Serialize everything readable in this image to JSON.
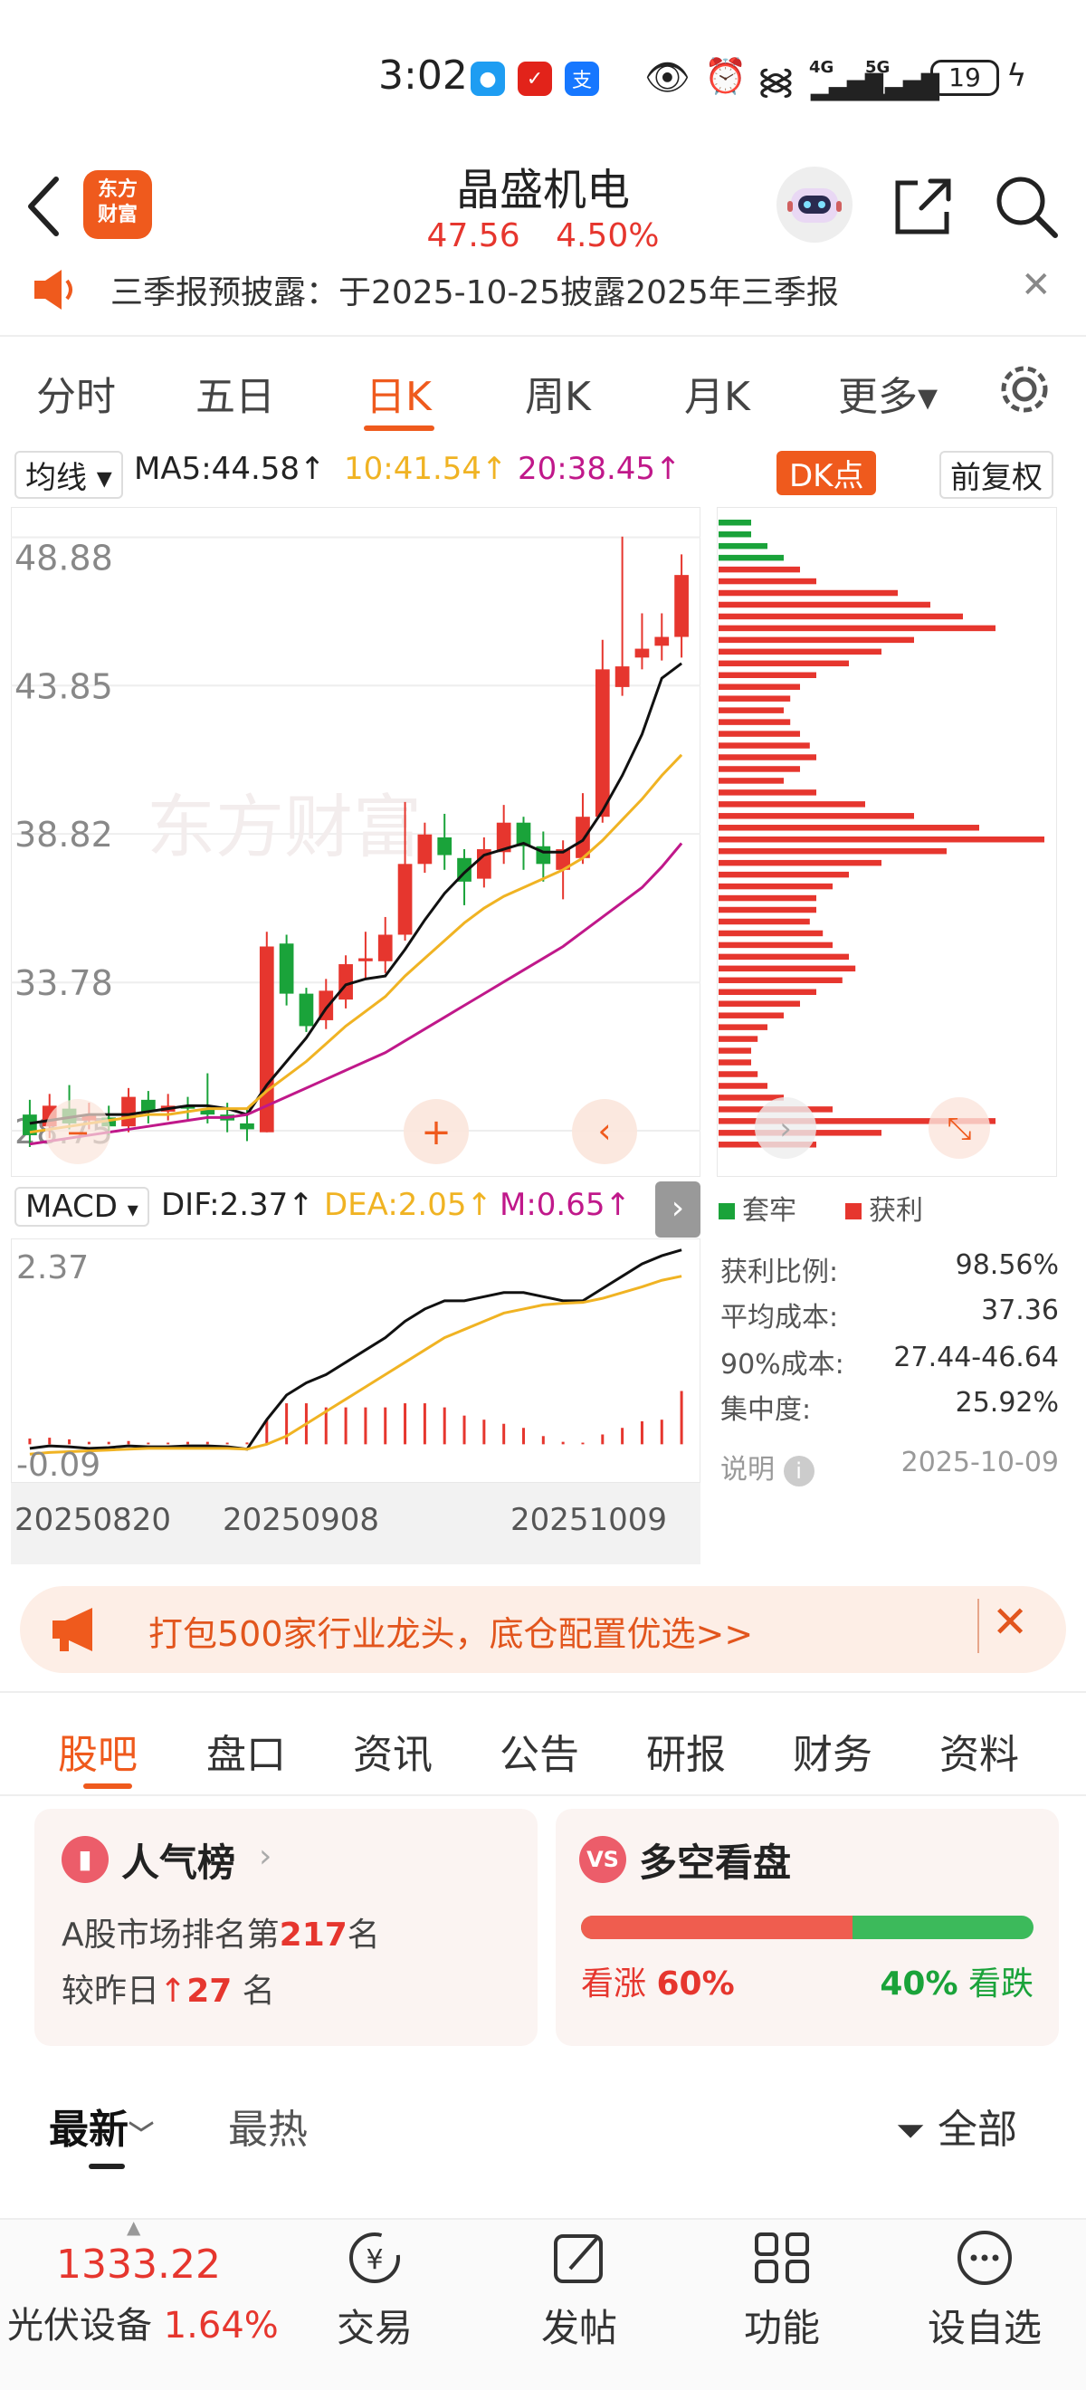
{
  "status_bar": {
    "time": "3:02",
    "battery": "19",
    "network_labels": [
      "4G",
      "5G"
    ],
    "app_icons": [
      "message-icon",
      "app-red-icon",
      "alipay-icon"
    ]
  },
  "header": {
    "logo_text_line1": "东方",
    "logo_text_line2": "财富",
    "stock_name": "晶盛机电",
    "price": "47.56",
    "change_pct": "4.50%"
  },
  "notice": {
    "text": "三季报预披露：于2025-10-25披露2025年三季报"
  },
  "period_tabs": [
    {
      "label": "分时"
    },
    {
      "label": "五日"
    },
    {
      "label": "日K"
    },
    {
      "label": "周K"
    },
    {
      "label": "月K"
    },
    {
      "label": "更多▾"
    }
  ],
  "ma_legend": {
    "selector": "均线",
    "ma5": "MA5:44.58↑",
    "ma10": "10:41.54↑",
    "ma20": "20:38.45↑",
    "dk_button": "DK点",
    "adjust_button": "前复权"
  },
  "price_axis": [
    "48.88",
    "43.85",
    "38.82",
    "33.78",
    "28.75"
  ],
  "macd_legend": {
    "selector": "MACD",
    "dif": "DIF:2.37↑",
    "dea": "DEA:2.05↑",
    "m": "M:0.65↑"
  },
  "macd_axis": {
    "top": "2.37",
    "bottom": "-0.09"
  },
  "date_axis": [
    "20250820",
    "20250908",
    "20251009"
  ],
  "chip_legend": {
    "trapped": "套牢",
    "profit": "获利"
  },
  "chip_stats": [
    {
      "label": "获利比例:",
      "value": "98.56%"
    },
    {
      "label": "平均成本:",
      "value": "37.36"
    },
    {
      "label": "90%成本:",
      "value": "27.44-46.64"
    },
    {
      "label": "集中度:",
      "value": "25.92%"
    }
  ],
  "chip_note": {
    "label": "说明",
    "date": "2025-10-09"
  },
  "promo": {
    "text": "打包500家行业龙头，底仓配置优选>>"
  },
  "section_tabs": [
    {
      "label": "股吧"
    },
    {
      "label": "盘口"
    },
    {
      "label": "资讯"
    },
    {
      "label": "公告"
    },
    {
      "label": "研报"
    },
    {
      "label": "财务"
    },
    {
      "label": "资料"
    }
  ],
  "popularity_card": {
    "title": "人气榜",
    "line1_prefix": "A股市场排名第",
    "rank": "217",
    "line1_suffix": "名",
    "line2_prefix": "较昨日",
    "change": "27",
    "line2_suffix": "名"
  },
  "sentiment_card": {
    "title": "多空看盘",
    "bull_label": "看涨",
    "bull_pct": "60%",
    "bear_pct": "40%",
    "bear_label": "看跌",
    "bull_fraction": 0.6
  },
  "feed_tabs": {
    "latest": "最新",
    "hot": "最热",
    "filter": "全部"
  },
  "bottom_bar": {
    "index_value": "1333.22",
    "index_name": "光伏设备",
    "index_change": "1.64%",
    "items": [
      {
        "label": "交易"
      },
      {
        "label": "发帖"
      },
      {
        "label": "功能"
      },
      {
        "label": "设自选"
      }
    ]
  },
  "colors": {
    "accent": "#ef5a1d",
    "up": "#e6362e",
    "down": "#1aa33a",
    "ma5": "#111111",
    "ma10": "#f0b323",
    "ma20": "#c0188a"
  },
  "chart_data": {
    "type": "candlestick",
    "ylim": [
      27.8,
      49.6
    ],
    "candles": [
      {
        "o": 29.3,
        "c": 28.6,
        "h": 29.8,
        "l": 28.2
      },
      {
        "o": 28.9,
        "c": 29.6,
        "h": 30.0,
        "l": 28.5
      },
      {
        "o": 29.5,
        "c": 29.0,
        "h": 30.3,
        "l": 28.8
      },
      {
        "o": 29.1,
        "c": 29.3,
        "h": 29.7,
        "l": 28.8
      },
      {
        "o": 29.2,
        "c": 28.9,
        "h": 29.6,
        "l": 28.6
      },
      {
        "o": 28.9,
        "c": 29.9,
        "h": 30.2,
        "l": 28.7
      },
      {
        "o": 29.8,
        "c": 29.4,
        "h": 30.1,
        "l": 29.0
      },
      {
        "o": 29.4,
        "c": 29.6,
        "h": 30.0,
        "l": 29.1
      },
      {
        "o": 29.6,
        "c": 29.5,
        "h": 29.9,
        "l": 29.1
      },
      {
        "o": 29.5,
        "c": 29.3,
        "h": 30.7,
        "l": 29.0
      },
      {
        "o": 29.3,
        "c": 29.1,
        "h": 29.7,
        "l": 28.7
      },
      {
        "o": 29.0,
        "c": 28.8,
        "h": 29.5,
        "l": 28.4
      },
      {
        "o": 28.7,
        "c": 35.0,
        "h": 35.5,
        "l": 28.7
      },
      {
        "o": 35.1,
        "c": 33.4,
        "h": 35.4,
        "l": 33.0
      },
      {
        "o": 33.4,
        "c": 32.3,
        "h": 33.6,
        "l": 32.1
      },
      {
        "o": 32.5,
        "c": 33.5,
        "h": 33.9,
        "l": 32.2
      },
      {
        "o": 33.2,
        "c": 34.4,
        "h": 34.7,
        "l": 32.9
      },
      {
        "o": 34.5,
        "c": 34.6,
        "h": 35.5,
        "l": 33.9
      },
      {
        "o": 34.5,
        "c": 35.4,
        "h": 36.0,
        "l": 34.1
      },
      {
        "o": 35.4,
        "c": 37.8,
        "h": 39.9,
        "l": 35.2
      },
      {
        "o": 37.8,
        "c": 38.8,
        "h": 39.2,
        "l": 37.5
      },
      {
        "o": 38.7,
        "c": 38.1,
        "h": 39.5,
        "l": 37.6
      },
      {
        "o": 38.0,
        "c": 37.2,
        "h": 38.3,
        "l": 36.4
      },
      {
        "o": 37.3,
        "c": 38.3,
        "h": 38.7,
        "l": 37.0
      },
      {
        "o": 38.2,
        "c": 39.2,
        "h": 39.8,
        "l": 37.8
      },
      {
        "o": 39.2,
        "c": 38.4,
        "h": 39.4,
        "l": 37.6
      },
      {
        "o": 38.4,
        "c": 37.8,
        "h": 38.9,
        "l": 37.2
      },
      {
        "o": 37.6,
        "c": 38.3,
        "h": 38.6,
        "l": 36.6
      },
      {
        "o": 38.0,
        "c": 39.4,
        "h": 40.2,
        "l": 37.8
      },
      {
        "o": 39.4,
        "c": 44.4,
        "h": 45.4,
        "l": 39.2
      },
      {
        "o": 43.8,
        "c": 44.5,
        "h": 48.9,
        "l": 43.5
      },
      {
        "o": 44.8,
        "c": 45.1,
        "h": 46.3,
        "l": 44.4
      },
      {
        "o": 45.2,
        "c": 45.5,
        "h": 46.3,
        "l": 44.7
      },
      {
        "o": 45.5,
        "c": 47.6,
        "h": 48.3,
        "l": 44.8
      }
    ],
    "ma5": [
      29.0,
      29.1,
      29.2,
      29.3,
      29.3,
      29.3,
      29.4,
      29.5,
      29.6,
      29.6,
      29.5,
      29.3,
      30.3,
      31.1,
      31.9,
      32.9,
      33.7,
      33.9,
      34.0,
      34.9,
      35.9,
      36.8,
      37.5,
      38.1,
      38.3,
      38.5,
      38.2,
      38.2,
      38.6,
      39.6,
      40.8,
      42.2,
      44.1,
      44.6
    ],
    "ma10": [
      28.7,
      28.8,
      28.9,
      29.0,
      29.1,
      29.2,
      29.3,
      29.3,
      29.4,
      29.5,
      29.5,
      29.5,
      30.1,
      30.6,
      31.1,
      31.7,
      32.3,
      32.8,
      33.3,
      34.0,
      34.6,
      35.2,
      35.8,
      36.3,
      36.7,
      37.0,
      37.3,
      37.6,
      38.0,
      38.6,
      39.3,
      40.0,
      40.8,
      41.5
    ],
    "ma20": [
      28.3,
      28.4,
      28.5,
      28.6,
      28.7,
      28.8,
      28.9,
      29.0,
      29.1,
      29.2,
      29.2,
      29.3,
      29.6,
      29.9,
      30.2,
      30.5,
      30.8,
      31.1,
      31.4,
      31.8,
      32.2,
      32.6,
      33.0,
      33.4,
      33.8,
      34.2,
      34.6,
      35.0,
      35.5,
      36.0,
      36.5,
      37.0,
      37.7,
      38.5
    ],
    "chip_distribution": [
      0.1,
      0.1,
      0.15,
      0.2,
      0.25,
      0.3,
      0.55,
      0.65,
      0.75,
      0.85,
      0.6,
      0.5,
      0.4,
      0.3,
      0.25,
      0.22,
      0.2,
      0.22,
      0.25,
      0.28,
      0.3,
      0.25,
      0.2,
      0.3,
      0.45,
      0.6,
      0.8,
      1.0,
      0.7,
      0.5,
      0.4,
      0.35,
      0.3,
      0.3,
      0.28,
      0.32,
      0.35,
      0.4,
      0.42,
      0.38,
      0.3,
      0.25,
      0.2,
      0.15,
      0.12,
      0.1,
      0.1,
      0.12,
      0.15,
      0.2,
      0.35,
      0.85,
      0.5,
      0.3
    ],
    "macd": {
      "dif": [
        -0.05,
        -0.02,
        -0.03,
        -0.05,
        -0.04,
        -0.02,
        -0.03,
        -0.03,
        -0.02,
        -0.02,
        -0.03,
        -0.06,
        0.3,
        0.6,
        0.75,
        0.85,
        1.0,
        1.15,
        1.3,
        1.5,
        1.65,
        1.75,
        1.75,
        1.8,
        1.85,
        1.85,
        1.8,
        1.75,
        1.75,
        1.9,
        2.05,
        2.2,
        2.3,
        2.37
      ],
      "dea": [
        -0.12,
        -0.1,
        -0.09,
        -0.08,
        -0.07,
        -0.06,
        -0.05,
        -0.05,
        -0.05,
        -0.05,
        -0.05,
        -0.06,
        0.0,
        0.1,
        0.25,
        0.4,
        0.55,
        0.7,
        0.85,
        1.0,
        1.15,
        1.3,
        1.4,
        1.5,
        1.6,
        1.65,
        1.7,
        1.72,
        1.73,
        1.78,
        1.85,
        1.92,
        2.0,
        2.05
      ],
      "hist": [
        0.07,
        0.08,
        0.06,
        0.03,
        0.03,
        0.04,
        0.02,
        0.02,
        0.03,
        0.03,
        0.02,
        0.0,
        0.3,
        0.5,
        0.5,
        0.45,
        0.45,
        0.45,
        0.45,
        0.5,
        0.5,
        0.45,
        0.35,
        0.3,
        0.25,
        0.2,
        0.1,
        0.03,
        0.02,
        0.12,
        0.2,
        0.28,
        0.3,
        0.65
      ],
      "ylim": [
        -0.25,
        2.4
      ]
    }
  }
}
